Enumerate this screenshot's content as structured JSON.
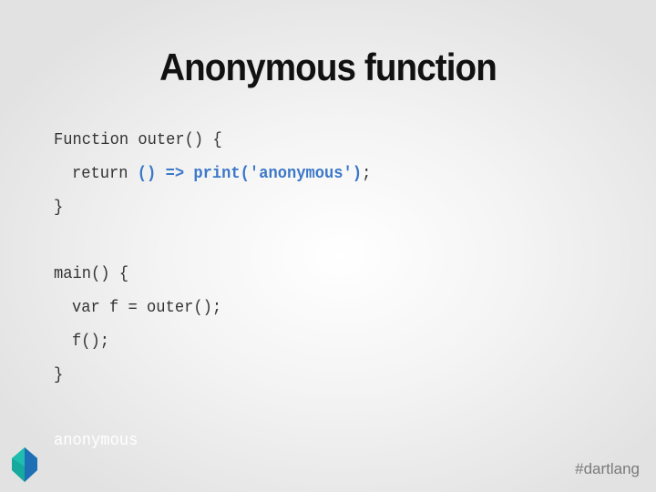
{
  "slide": {
    "title": "Anonymous function",
    "code": {
      "line1": "Function outer() {",
      "line2_keyword": "return ",
      "line2_highlight": "() => print('anonymous')",
      "line2_end": ";",
      "line3": "}",
      "line5": "main() {",
      "line6": "var f = outer();",
      "line7": "f();",
      "line8": "}"
    },
    "output": "anonymous",
    "hashtag": "#dartlang",
    "logo_icon": "dart-logo-icon"
  },
  "colors": {
    "highlight": "#3c78c8",
    "code_text": "#333333",
    "title": "#111111",
    "hashtag": "#7a7a7a",
    "logo_teal": "#1ebdb0",
    "logo_blue": "#1f6fb5"
  }
}
